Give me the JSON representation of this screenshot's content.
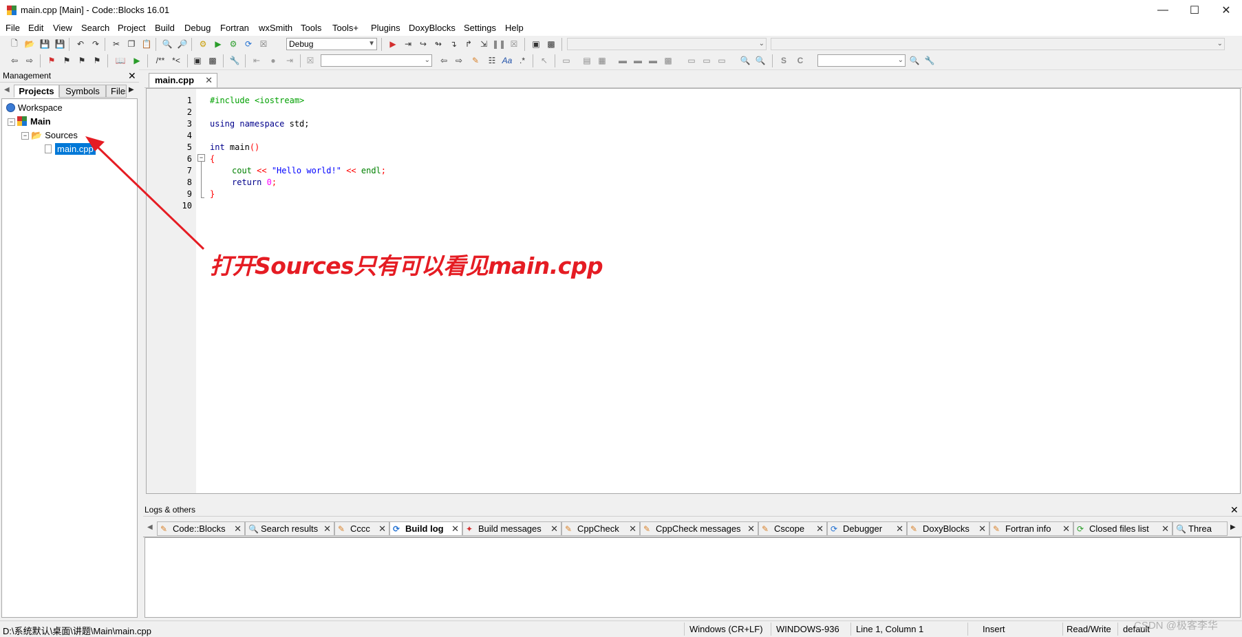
{
  "window": {
    "title": "main.cpp [Main] - Code::Blocks 16.01"
  },
  "menu": [
    "File",
    "Edit",
    "View",
    "Search",
    "Project",
    "Build",
    "Debug",
    "Fortran",
    "wxSmith",
    "Tools",
    "Tools+",
    "Plugins",
    "DoxyBlocks",
    "Settings",
    "Help"
  ],
  "toolbar": {
    "build_target": "Debug",
    "block_comment": "/**",
    "line_comment": "*<"
  },
  "management": {
    "title": "Management",
    "tabs": [
      "Projects",
      "Symbols",
      "Files"
    ],
    "tree": {
      "workspace": "Workspace",
      "project": "Main",
      "folder": "Sources",
      "file": "main.cpp"
    }
  },
  "editor": {
    "tab": "main.cpp",
    "line_numbers": [
      "1",
      "2",
      "3",
      "4",
      "5",
      "6",
      "7",
      "8",
      "9",
      "10"
    ],
    "code": {
      "l1": "#include <iostream>",
      "l3_kw": "using namespace",
      "l3_rest": " std;",
      "l5_kw": "int",
      "l5_rest": " main",
      "l5_par": "()",
      "l6": "{",
      "l7_a": "cout",
      "l7_op1": " << ",
      "l7_str": "\"Hello world!\"",
      "l7_op2": " << ",
      "l7_b": "endl",
      "l7_semi": ";",
      "l8_kw": "return",
      "l8_num": "0",
      "l8_semi": ";",
      "l9": "}"
    }
  },
  "annotation": "打开Sources只有可以看见main.cpp",
  "logs": {
    "title": "Logs & others",
    "tabs": [
      "Code::Blocks",
      "Search results",
      "Cccc",
      "Build log",
      "Build messages",
      "CppCheck",
      "CppCheck messages",
      "Cscope",
      "Debugger",
      "DoxyBlocks",
      "Fortran info",
      "Closed files list",
      "Threa"
    ],
    "active_tab": "Build log"
  },
  "status": {
    "path": "D:\\系统默认\\桌面\\讲题\\Main\\main.cpp",
    "eol": "Windows (CR+LF)",
    "encoding": "WINDOWS-936",
    "position": "Line 1, Column 1",
    "mode": "Insert",
    "access": "Read/Write",
    "profile": "default"
  },
  "watermark": "CSDN @极客李华",
  "colors": {
    "annotation": "#e51c23",
    "selection": "#0078d7",
    "preprocessor": "#00a000",
    "keyword": "#00008b",
    "string": "#0000ff",
    "operator": "#ff0000"
  }
}
